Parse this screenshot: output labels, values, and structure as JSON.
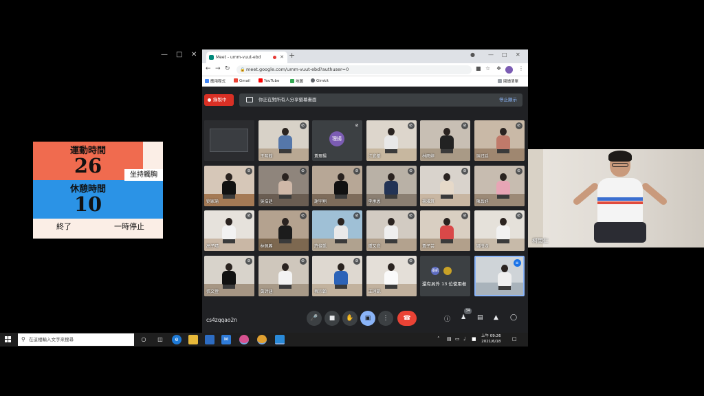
{
  "timer": {
    "exercise_label": "運動時間",
    "exercise_value": "26",
    "side_note": "坐持觸胸",
    "rest_label": "休憩時間",
    "rest_value": "10",
    "end_label": "終了",
    "pause_label": "一時停止",
    "colors": {
      "exercise": "#f06b4f",
      "rest": "#2b93e6",
      "background": "#fbeee6"
    }
  },
  "browser": {
    "tab_title": "Meet - umm-vuut-ebd",
    "url": "meet.google.com/umm-vuut-ebd?authuser=0",
    "bookmarks": [
      "應用程式",
      "Gmail",
      "YouTube",
      "地圖",
      "Gimkit"
    ],
    "reading_list": "閱讀清單"
  },
  "meet": {
    "recording_label": "錄製中",
    "share_notice": "你正在對所有人分享螢幕畫面",
    "stop_label": "停止顯示",
    "meeting_code": "cs4zqqao2n",
    "people_count": "34",
    "accent": "#8ab4f8",
    "hangup_color": "#ea4335",
    "tiles": [
      {
        "name": "",
        "kind": "screen"
      },
      {
        "name": "王明翰",
        "kind": "video"
      },
      {
        "name": "黃理揚",
        "kind": "avatar",
        "avatar_text": "理揚"
      },
      {
        "name": "江宜蓁",
        "kind": "video"
      },
      {
        "name": "林雨婷",
        "kind": "video"
      },
      {
        "name": "吳冠廷",
        "kind": "video"
      },
      {
        "name": "劉家瑜",
        "kind": "video"
      },
      {
        "name": "吳浩廷",
        "kind": "video"
      },
      {
        "name": "謝宇翔",
        "kind": "video"
      },
      {
        "name": "李承恩",
        "kind": "video"
      },
      {
        "name": "楊雅筑",
        "kind": "video"
      },
      {
        "name": "陳品妤",
        "kind": "video"
      },
      {
        "name": "高子晴",
        "kind": "video"
      },
      {
        "name": "林佩蓉",
        "kind": "video"
      },
      {
        "name": "許俊凱",
        "kind": "video"
      },
      {
        "name": "鍾又安",
        "kind": "video"
      },
      {
        "name": "黃子芸",
        "kind": "video"
      },
      {
        "name": "周柏均",
        "kind": "video"
      },
      {
        "name": "張文萱",
        "kind": "video"
      },
      {
        "name": "黃詩涵",
        "kind": "video"
      },
      {
        "name": "蔡宗翰",
        "kind": "video"
      },
      {
        "name": "王翊凱",
        "kind": "video"
      },
      {
        "name": "還有另外 13 位使用者",
        "kind": "others",
        "avatar_text": "墨凱"
      },
      {
        "name": "",
        "kind": "self"
      }
    ]
  },
  "presenter": {
    "name": "柯閎仁"
  },
  "taskbar": {
    "search_placeholder": "在這裡輸入文字來搜尋",
    "time": "上午 09:26",
    "date": "2021/6/18"
  }
}
